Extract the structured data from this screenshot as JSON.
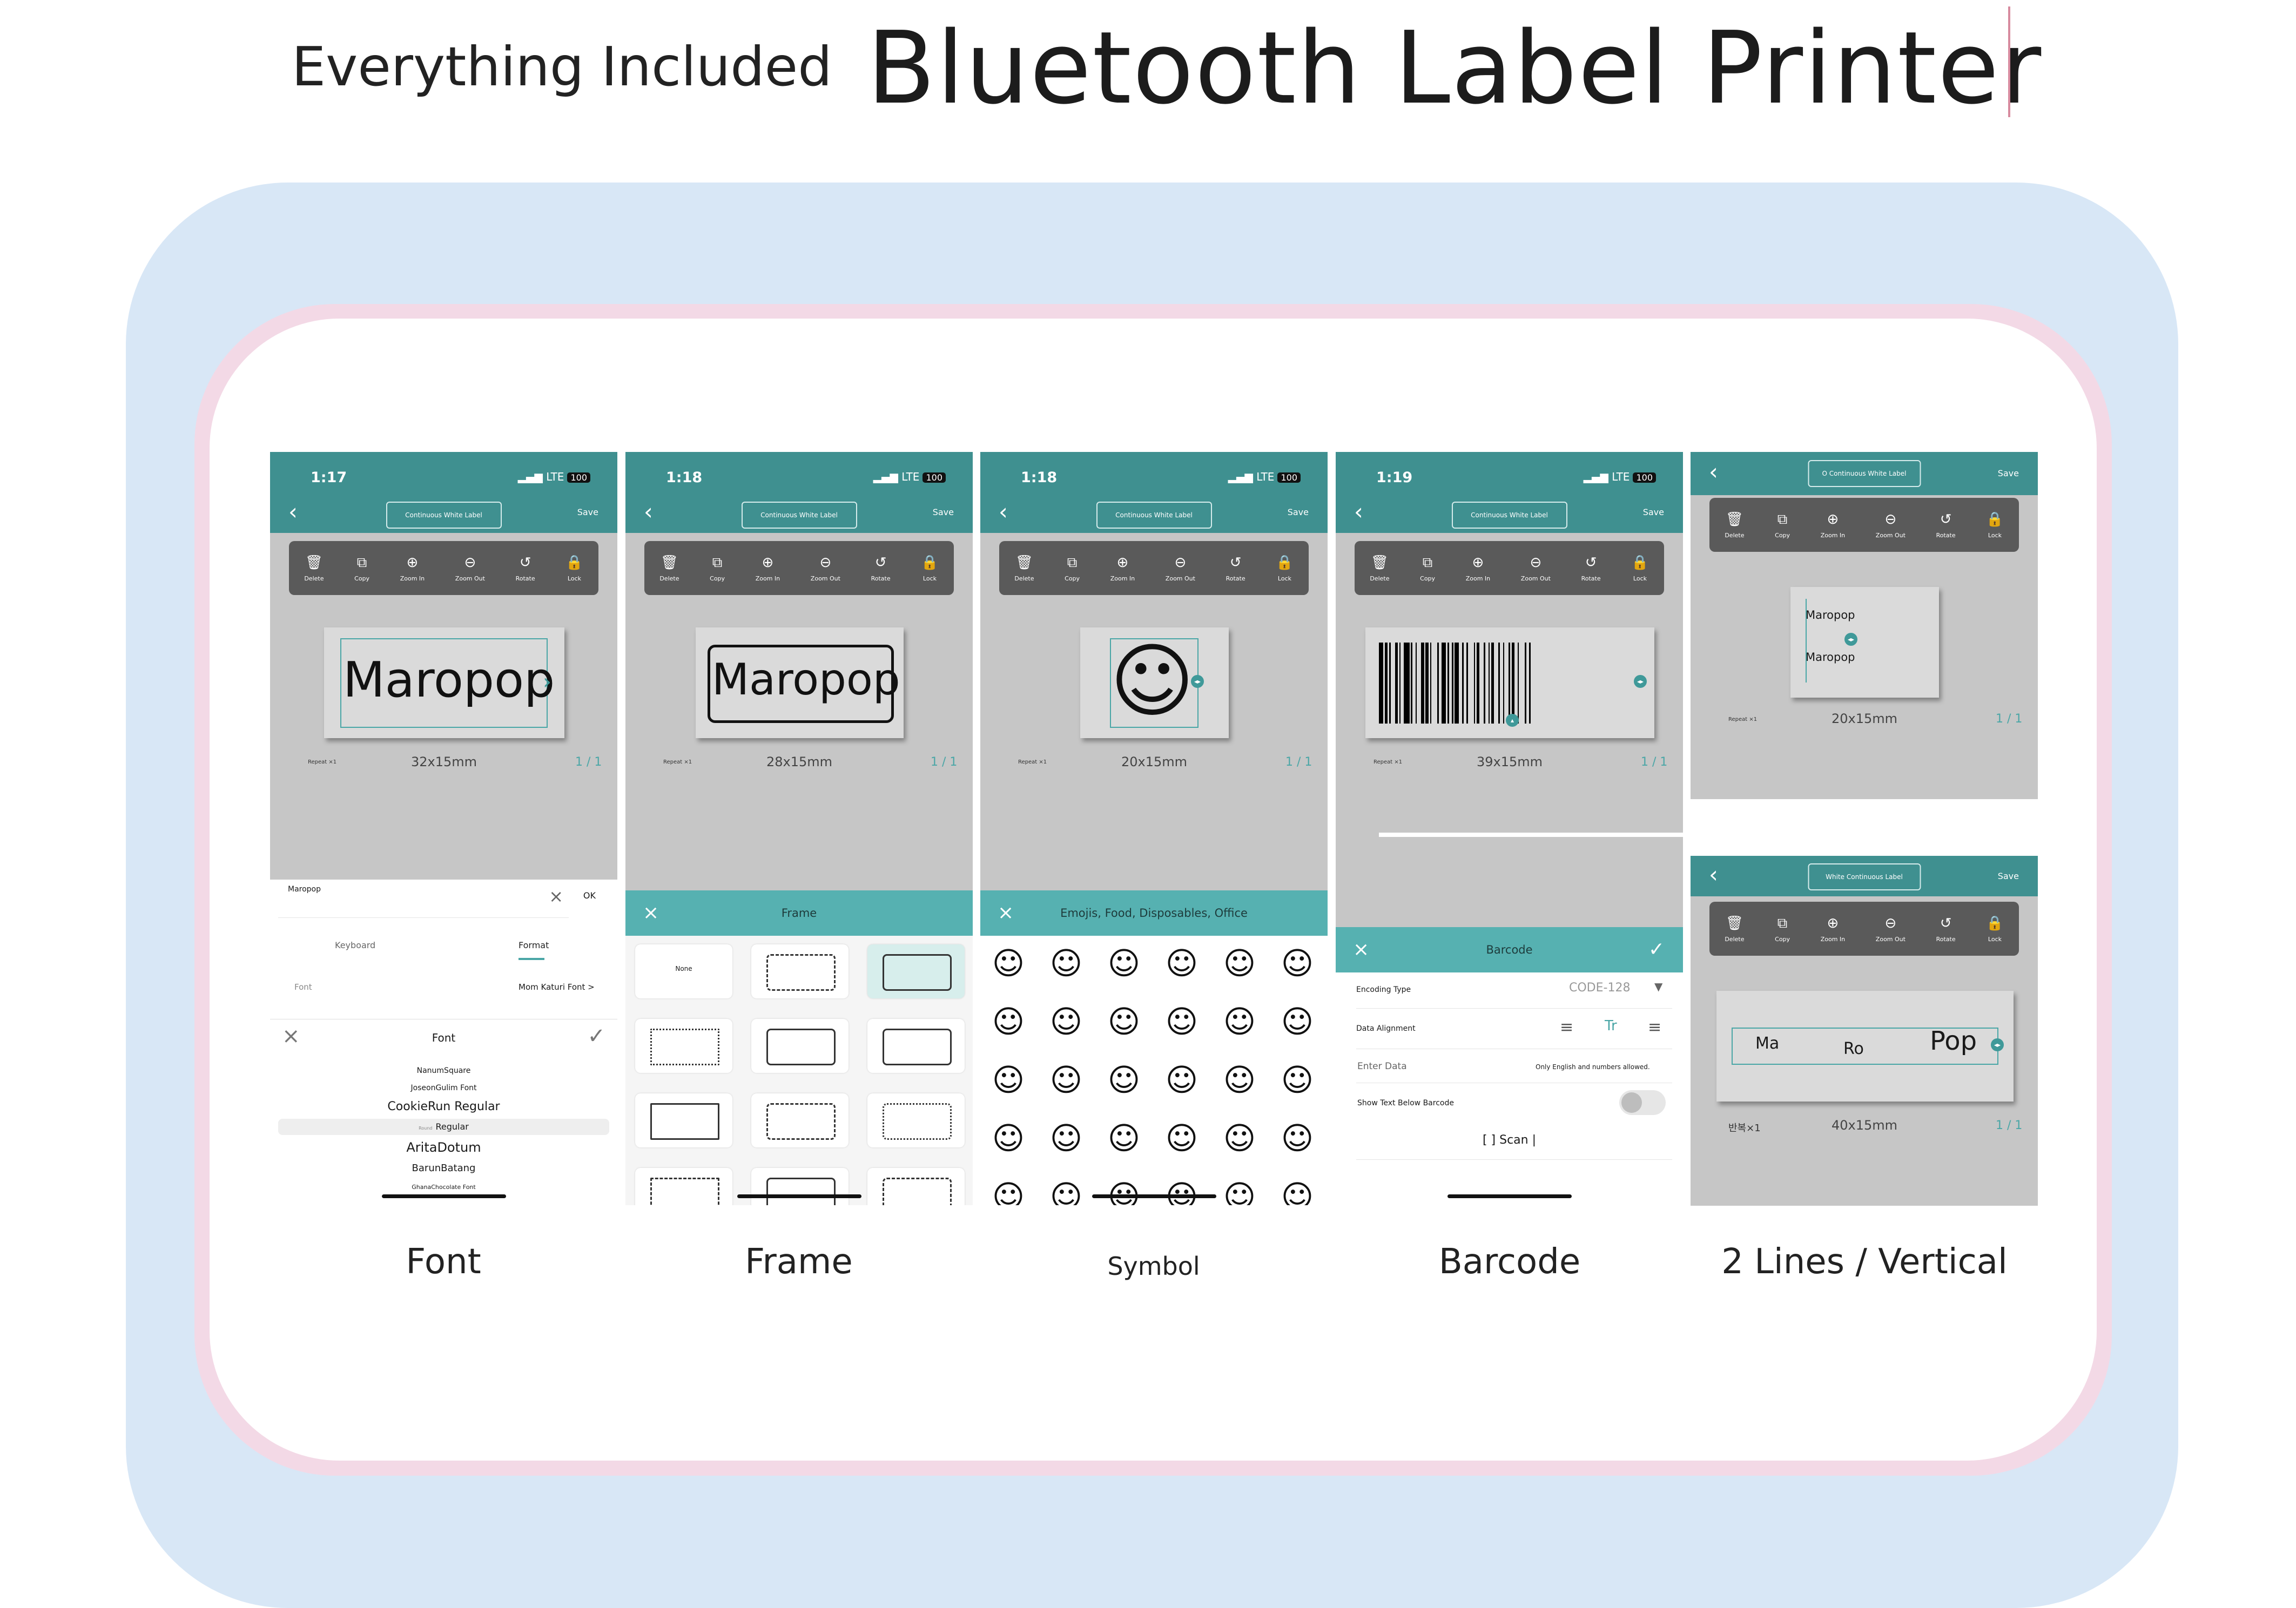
{
  "header": {
    "subtitle": "Everything Included",
    "title": "Bluetooth Label Printer"
  },
  "toolbar_items": [
    {
      "label": "Delete",
      "icon": "trash-icon"
    },
    {
      "label": "Copy",
      "icon": "copy-icon"
    },
    {
      "label": "Zoom In",
      "icon": "zoom-in-icon"
    },
    {
      "label": "Zoom Out",
      "icon": "zoom-out-icon"
    },
    {
      "label": "Rotate",
      "icon": "rotate-icon"
    },
    {
      "label": "Lock",
      "icon": "lock-icon"
    }
  ],
  "status": {
    "signal": "LTE",
    "battery": "100"
  },
  "nav": {
    "save": "Save"
  },
  "repeat_label": "Repeat ×1",
  "phones": {
    "font": {
      "time": "1:17",
      "label_type": "Continuous White Label",
      "label_text": "Maropop",
      "size": "32x15mm",
      "pages": "1 / 1",
      "input_value": "Maropop",
      "ok": "OK",
      "tabs": [
        "Keyboard",
        "Format"
      ],
      "font_row_label": "Font",
      "font_row_value": "Mom Katuri Font >",
      "sheet_title": "Font",
      "fonts": [
        "NanumSquare",
        "JoseonGulim Font",
        "CookieRun Regular",
        "Regular",
        "AritaDotum",
        "BarunBatang",
        "GhanaChocolate Font"
      ],
      "selected_prefix": "Round"
    },
    "frame": {
      "time": "1:18",
      "label_type": "Continuous White Label",
      "label_text": "Maropop",
      "size": "28x15mm",
      "pages": "1 / 1",
      "sheet_title": "Frame",
      "none_label": "None"
    },
    "symbol": {
      "time": "1:18",
      "label_type": "Continuous White Label",
      "size": "20x15mm",
      "pages": "1 / 1",
      "sheet_title": "Emojis, Food, Disposables, Office",
      "emojis": [
        "☺",
        "☺",
        "☺",
        "☺",
        "☺",
        "☺",
        "☺",
        "☺",
        "☺",
        "☺",
        "☺",
        "☺",
        "☺",
        "☺",
        "☺",
        "☺",
        "☺",
        "☺",
        "☺",
        "☺",
        "☺",
        "☺",
        "☺",
        "☺",
        "☺",
        "☺",
        "☺",
        "☺",
        "☺",
        "☺"
      ]
    },
    "barcode": {
      "time": "1:19",
      "label_type": "Continuous White Label",
      "size": "39x15mm",
      "pages": "1 / 1",
      "sheet_title": "Barcode",
      "encoding_label": "Encoding Type",
      "encoding_value": "CODE-128",
      "alignment_label": "Data Alignment",
      "align_center": "Tr",
      "enter_label": "Enter Data",
      "enter_hint": "Only English and numbers allowed.",
      "show_text_label": "Show Text Below Barcode",
      "scan_label": "[ ] Scan"
    },
    "two_lines": {
      "label_type": "O Continuous White Label",
      "line1": "Maropop",
      "line2": "Maropop",
      "size": "20x15mm",
      "pages": "1 / 1"
    },
    "vertical": {
      "label_type": "White Continuous Label",
      "text_a": "Ma",
      "text_b": "Ro",
      "text_c": "Pop",
      "repeat": "반복×1",
      "size": "40x15mm",
      "pages": "1 / 1"
    }
  },
  "captions": [
    "Font",
    "Frame",
    "Symbol",
    "Barcode",
    "2 Lines / Vertical"
  ]
}
